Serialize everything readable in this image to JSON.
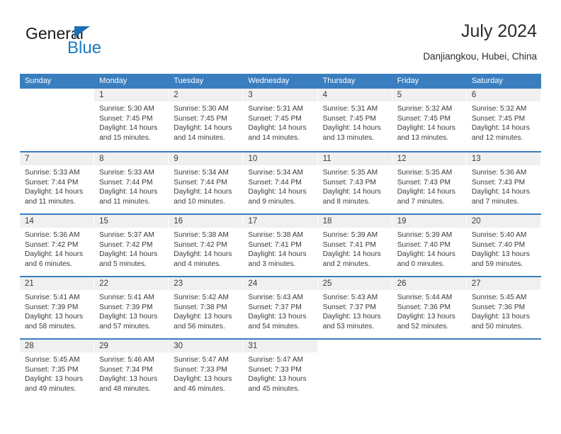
{
  "brand": {
    "name_part1": "General",
    "name_part2": "Blue",
    "triangle_icon": "triangle-icon",
    "accent_color": "#1b7ac0"
  },
  "header": {
    "title": "July 2024",
    "subtitle": "Danjiangkou, Hubei, China"
  },
  "calendar": {
    "header_bg": "#3a7ec0",
    "daynum_bg": "#f0f0f0",
    "weekdays": [
      "Sunday",
      "Monday",
      "Tuesday",
      "Wednesday",
      "Thursday",
      "Friday",
      "Saturday"
    ],
    "weeks": [
      [
        {
          "day": "",
          "empty": true
        },
        {
          "day": "1",
          "sunrise": "Sunrise: 5:30 AM",
          "sunset": "Sunset: 7:45 PM",
          "daylight1": "Daylight: 14 hours",
          "daylight2": "and 15 minutes."
        },
        {
          "day": "2",
          "sunrise": "Sunrise: 5:30 AM",
          "sunset": "Sunset: 7:45 PM",
          "daylight1": "Daylight: 14 hours",
          "daylight2": "and 14 minutes."
        },
        {
          "day": "3",
          "sunrise": "Sunrise: 5:31 AM",
          "sunset": "Sunset: 7:45 PM",
          "daylight1": "Daylight: 14 hours",
          "daylight2": "and 14 minutes."
        },
        {
          "day": "4",
          "sunrise": "Sunrise: 5:31 AM",
          "sunset": "Sunset: 7:45 PM",
          "daylight1": "Daylight: 14 hours",
          "daylight2": "and 13 minutes."
        },
        {
          "day": "5",
          "sunrise": "Sunrise: 5:32 AM",
          "sunset": "Sunset: 7:45 PM",
          "daylight1": "Daylight: 14 hours",
          "daylight2": "and 13 minutes."
        },
        {
          "day": "6",
          "sunrise": "Sunrise: 5:32 AM",
          "sunset": "Sunset: 7:45 PM",
          "daylight1": "Daylight: 14 hours",
          "daylight2": "and 12 minutes."
        }
      ],
      [
        {
          "day": "7",
          "sunrise": "Sunrise: 5:33 AM",
          "sunset": "Sunset: 7:44 PM",
          "daylight1": "Daylight: 14 hours",
          "daylight2": "and 11 minutes."
        },
        {
          "day": "8",
          "sunrise": "Sunrise: 5:33 AM",
          "sunset": "Sunset: 7:44 PM",
          "daylight1": "Daylight: 14 hours",
          "daylight2": "and 11 minutes."
        },
        {
          "day": "9",
          "sunrise": "Sunrise: 5:34 AM",
          "sunset": "Sunset: 7:44 PM",
          "daylight1": "Daylight: 14 hours",
          "daylight2": "and 10 minutes."
        },
        {
          "day": "10",
          "sunrise": "Sunrise: 5:34 AM",
          "sunset": "Sunset: 7:44 PM",
          "daylight1": "Daylight: 14 hours",
          "daylight2": "and 9 minutes."
        },
        {
          "day": "11",
          "sunrise": "Sunrise: 5:35 AM",
          "sunset": "Sunset: 7:43 PM",
          "daylight1": "Daylight: 14 hours",
          "daylight2": "and 8 minutes."
        },
        {
          "day": "12",
          "sunrise": "Sunrise: 5:35 AM",
          "sunset": "Sunset: 7:43 PM",
          "daylight1": "Daylight: 14 hours",
          "daylight2": "and 7 minutes."
        },
        {
          "day": "13",
          "sunrise": "Sunrise: 5:36 AM",
          "sunset": "Sunset: 7:43 PM",
          "daylight1": "Daylight: 14 hours",
          "daylight2": "and 7 minutes."
        }
      ],
      [
        {
          "day": "14",
          "sunrise": "Sunrise: 5:36 AM",
          "sunset": "Sunset: 7:42 PM",
          "daylight1": "Daylight: 14 hours",
          "daylight2": "and 6 minutes."
        },
        {
          "day": "15",
          "sunrise": "Sunrise: 5:37 AM",
          "sunset": "Sunset: 7:42 PM",
          "daylight1": "Daylight: 14 hours",
          "daylight2": "and 5 minutes."
        },
        {
          "day": "16",
          "sunrise": "Sunrise: 5:38 AM",
          "sunset": "Sunset: 7:42 PM",
          "daylight1": "Daylight: 14 hours",
          "daylight2": "and 4 minutes."
        },
        {
          "day": "17",
          "sunrise": "Sunrise: 5:38 AM",
          "sunset": "Sunset: 7:41 PM",
          "daylight1": "Daylight: 14 hours",
          "daylight2": "and 3 minutes."
        },
        {
          "day": "18",
          "sunrise": "Sunrise: 5:39 AM",
          "sunset": "Sunset: 7:41 PM",
          "daylight1": "Daylight: 14 hours",
          "daylight2": "and 2 minutes."
        },
        {
          "day": "19",
          "sunrise": "Sunrise: 5:39 AM",
          "sunset": "Sunset: 7:40 PM",
          "daylight1": "Daylight: 14 hours",
          "daylight2": "and 0 minutes."
        },
        {
          "day": "20",
          "sunrise": "Sunrise: 5:40 AM",
          "sunset": "Sunset: 7:40 PM",
          "daylight1": "Daylight: 13 hours",
          "daylight2": "and 59 minutes."
        }
      ],
      [
        {
          "day": "21",
          "sunrise": "Sunrise: 5:41 AM",
          "sunset": "Sunset: 7:39 PM",
          "daylight1": "Daylight: 13 hours",
          "daylight2": "and 58 minutes."
        },
        {
          "day": "22",
          "sunrise": "Sunrise: 5:41 AM",
          "sunset": "Sunset: 7:39 PM",
          "daylight1": "Daylight: 13 hours",
          "daylight2": "and 57 minutes."
        },
        {
          "day": "23",
          "sunrise": "Sunrise: 5:42 AM",
          "sunset": "Sunset: 7:38 PM",
          "daylight1": "Daylight: 13 hours",
          "daylight2": "and 56 minutes."
        },
        {
          "day": "24",
          "sunrise": "Sunrise: 5:43 AM",
          "sunset": "Sunset: 7:37 PM",
          "daylight1": "Daylight: 13 hours",
          "daylight2": "and 54 minutes."
        },
        {
          "day": "25",
          "sunrise": "Sunrise: 5:43 AM",
          "sunset": "Sunset: 7:37 PM",
          "daylight1": "Daylight: 13 hours",
          "daylight2": "and 53 minutes."
        },
        {
          "day": "26",
          "sunrise": "Sunrise: 5:44 AM",
          "sunset": "Sunset: 7:36 PM",
          "daylight1": "Daylight: 13 hours",
          "daylight2": "and 52 minutes."
        },
        {
          "day": "27",
          "sunrise": "Sunrise: 5:45 AM",
          "sunset": "Sunset: 7:36 PM",
          "daylight1": "Daylight: 13 hours",
          "daylight2": "and 50 minutes."
        }
      ],
      [
        {
          "day": "28",
          "sunrise": "Sunrise: 5:45 AM",
          "sunset": "Sunset: 7:35 PM",
          "daylight1": "Daylight: 13 hours",
          "daylight2": "and 49 minutes."
        },
        {
          "day": "29",
          "sunrise": "Sunrise: 5:46 AM",
          "sunset": "Sunset: 7:34 PM",
          "daylight1": "Daylight: 13 hours",
          "daylight2": "and 48 minutes."
        },
        {
          "day": "30",
          "sunrise": "Sunrise: 5:47 AM",
          "sunset": "Sunset: 7:33 PM",
          "daylight1": "Daylight: 13 hours",
          "daylight2": "and 46 minutes."
        },
        {
          "day": "31",
          "sunrise": "Sunrise: 5:47 AM",
          "sunset": "Sunset: 7:33 PM",
          "daylight1": "Daylight: 13 hours",
          "daylight2": "and 45 minutes."
        },
        {
          "day": "",
          "empty": true
        },
        {
          "day": "",
          "empty": true
        },
        {
          "day": "",
          "empty": true
        }
      ]
    ]
  }
}
